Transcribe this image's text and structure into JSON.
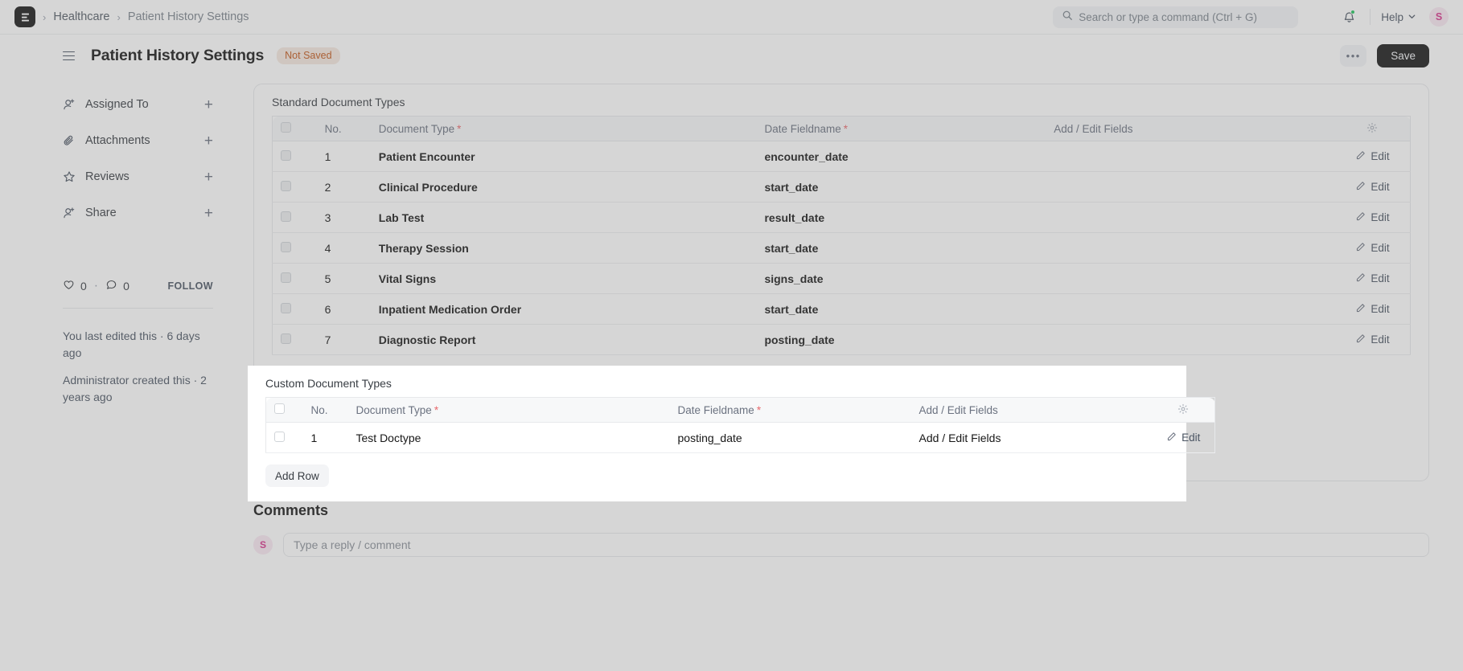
{
  "navbar": {
    "logo_letter": "E",
    "breadcrumbs": [
      {
        "label": "Healthcare",
        "current": false
      },
      {
        "label": "Patient History Settings",
        "current": true
      }
    ],
    "search": {
      "placeholder": "Search or type a command (Ctrl + G)",
      "value": "",
      "icon": "search-icon"
    },
    "notifications": {
      "icon": "bell-icon",
      "has_unread": true,
      "dot_color": "#22c55e"
    },
    "help": {
      "label": "Help",
      "icon": "chevron-down-icon"
    },
    "avatar": {
      "initial": "S",
      "bg": "#fae8f2",
      "fg": "#d6348c"
    }
  },
  "page_header": {
    "menu_icon": "hamburger-icon",
    "title": "Patient History Settings",
    "status_badge": {
      "label": "Not Saved",
      "color": "#c2571a",
      "bg": "#f5e9e0"
    },
    "more_label": "•••",
    "save_label": "Save"
  },
  "sidebar": {
    "items": [
      {
        "label": "Assigned To",
        "icon": "user-plus-icon",
        "add_icon": "plus-icon"
      },
      {
        "label": "Attachments",
        "icon": "paperclip-icon",
        "add_icon": "plus-icon"
      },
      {
        "label": "Reviews",
        "icon": "star-icon",
        "add_icon": "plus-icon"
      },
      {
        "label": "Share",
        "icon": "share-user-icon",
        "add_icon": "plus-icon"
      }
    ],
    "stats": {
      "likes": "0",
      "separator": "·",
      "comments": "0",
      "follow_label": "FOLLOW",
      "like_icon": "heart-icon",
      "comment_icon": "comment-icon"
    },
    "meta": [
      "You last edited this · 6 days ago",
      "Administrator created this · 2 years ago"
    ]
  },
  "standard_section": {
    "label": "Standard Document Types",
    "columns": [
      {
        "key": "chk",
        "label": "",
        "required": false,
        "icon": "checkbox-icon"
      },
      {
        "key": "no",
        "label": "No.",
        "required": false
      },
      {
        "key": "doc",
        "label": "Document Type",
        "required": true
      },
      {
        "key": "date",
        "label": "Date Fieldname",
        "required": true
      },
      {
        "key": "aef",
        "label": "Add / Edit Fields",
        "required": false
      },
      {
        "key": "act",
        "label": "",
        "required": false,
        "icon": "gear-icon"
      }
    ],
    "required_marker": "*",
    "rows": [
      {
        "no": "1",
        "document_type": "Patient Encounter",
        "date_fieldname": "encounter_date",
        "add_edit_fields": "",
        "action": "Edit"
      },
      {
        "no": "2",
        "document_type": "Clinical Procedure",
        "date_fieldname": "start_date",
        "add_edit_fields": "",
        "action": "Edit"
      },
      {
        "no": "3",
        "document_type": "Lab Test",
        "date_fieldname": "result_date",
        "add_edit_fields": "",
        "action": "Edit"
      },
      {
        "no": "4",
        "document_type": "Therapy Session",
        "date_fieldname": "start_date",
        "add_edit_fields": "",
        "action": "Edit"
      },
      {
        "no": "5",
        "document_type": "Vital Signs",
        "date_fieldname": "signs_date",
        "add_edit_fields": "",
        "action": "Edit"
      },
      {
        "no": "6",
        "document_type": "Inpatient Medication Order",
        "date_fieldname": "start_date",
        "add_edit_fields": "",
        "action": "Edit"
      },
      {
        "no": "7",
        "document_type": "Diagnostic Report",
        "date_fieldname": "posting_date",
        "add_edit_fields": "",
        "action": "Edit"
      }
    ]
  },
  "custom_section": {
    "label": "Custom Document Types",
    "highlighted": true,
    "columns": [
      {
        "key": "chk",
        "label": "",
        "required": false,
        "icon": "checkbox-icon"
      },
      {
        "key": "no",
        "label": "No.",
        "required": false
      },
      {
        "key": "doc",
        "label": "Document Type",
        "required": true
      },
      {
        "key": "date",
        "label": "Date Fieldname",
        "required": true
      },
      {
        "key": "aef",
        "label": "Add / Edit Fields",
        "required": false
      },
      {
        "key": "act",
        "label": "",
        "required": false,
        "icon": "gear-icon"
      }
    ],
    "required_marker": "*",
    "rows": [
      {
        "no": "1",
        "document_type": "Test Doctype",
        "date_fieldname": "posting_date",
        "add_edit_fields": "Add / Edit Fields",
        "action": "Edit"
      }
    ],
    "add_row_label": "Add Row"
  },
  "comments": {
    "heading": "Comments",
    "avatar_initial": "S",
    "input_placeholder": "Type a reply / comment",
    "input_value": ""
  }
}
